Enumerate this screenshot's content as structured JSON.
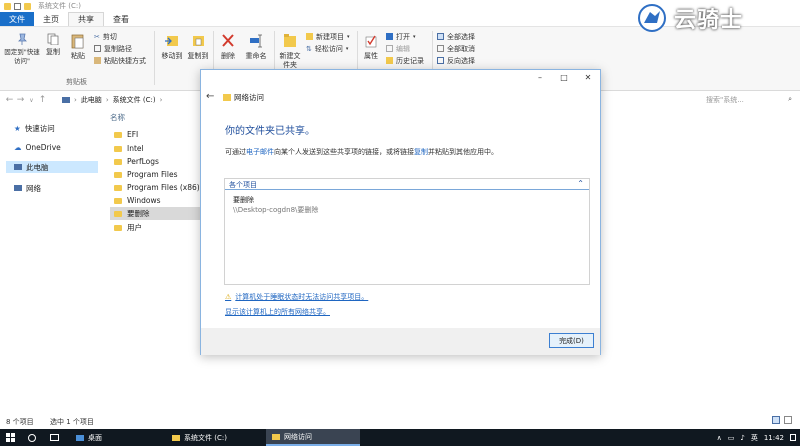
{
  "window": {
    "title": "系统文件 (C:)"
  },
  "ribbon": {
    "tabs": [
      "文件",
      "主页",
      "共享",
      "查看"
    ],
    "pin_label": "固定到\"快速访问\"",
    "copy_label": "复制",
    "paste_label": "粘贴",
    "cut_label": "剪切",
    "copy_path_label": "复制路径",
    "paste_shortcut_label": "粘贴快捷方式",
    "clipboard_group": "剪贴板",
    "move_to_label": "移动到",
    "copy_to_label": "复制到",
    "delete_label": "删除",
    "rename_label": "重命名",
    "new_folder_label": "新建文件夹",
    "new_item_label": "新建项目",
    "easy_access_label": "轻松访问",
    "properties_label": "属性",
    "open_label": "打开",
    "edit_label": "编辑",
    "history_label": "历史记录",
    "select_all_label": "全部选择",
    "select_none_label": "全部取消",
    "invert_label": "反向选择"
  },
  "address": {
    "segments": [
      "此电脑",
      "系统文件 (C:)"
    ],
    "search_placeholder": "搜索\"系统..."
  },
  "navpane": {
    "items": [
      "快速访问",
      "OneDrive",
      "此电脑",
      "网络"
    ]
  },
  "filelist": {
    "column": "名称",
    "rows": [
      "EFI",
      "Intel",
      "PerfLogs",
      "Program Files",
      "Program Files (x86)",
      "Windows",
      "要删除",
      "用户"
    ]
  },
  "dialog": {
    "title": "网络访问",
    "heading": "你的文件夹已共享。",
    "desc_prefix": "可通过",
    "desc_link1": "电子邮件",
    "desc_middle": "向某个人发送到这些共享项的链接，或将链接",
    "desc_link2": "复制",
    "desc_suffix": "并粘贴到其他应用中。",
    "items_header": "各个项目",
    "item_name": "要删除",
    "item_path": "\\\\Desktop-cogdn8\\要删除",
    "warning_link": "计算机处于睡眠状态时无法访问共享项目。",
    "network_link": "显示该计算机上的所有网络共享。",
    "done_label": "完成(D)"
  },
  "statusbar": {
    "count": "8 个项目",
    "selected": "选中 1 个项目"
  },
  "taskbar": {
    "desktop": "桌面",
    "explorer": "系统文件 (C:)",
    "dialog": "网络访问",
    "ime": "英",
    "time": "11:42"
  },
  "watermark": {
    "text": "云骑士"
  },
  "colors": {
    "accent": "#1a6fc9",
    "link": "#1f66c1",
    "heading": "#1f4e9c",
    "taskbar": "#101820"
  }
}
